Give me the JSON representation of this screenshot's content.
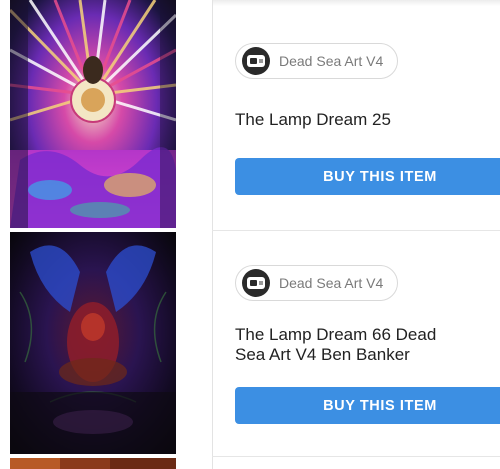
{
  "listings": [
    {
      "artist_label": "Dead Sea Art V4",
      "title": "The Lamp Dream 25",
      "buy_label": "BUY THIS ITEM",
      "thumbnail_icon": "psychedelic-artwork-image"
    },
    {
      "artist_label": "Dead Sea Art V4",
      "title": "The Lamp Dream 66 Dead Sea Art V4 Ben Banker",
      "buy_label": "BUY THIS ITEM",
      "thumbnail_icon": "dark-psychedelic-artwork-image"
    }
  ],
  "colors": {
    "button": "#3c8fe3",
    "button_text": "#ffffff",
    "chip_border": "#d9d9d9",
    "title_text": "#222222"
  }
}
